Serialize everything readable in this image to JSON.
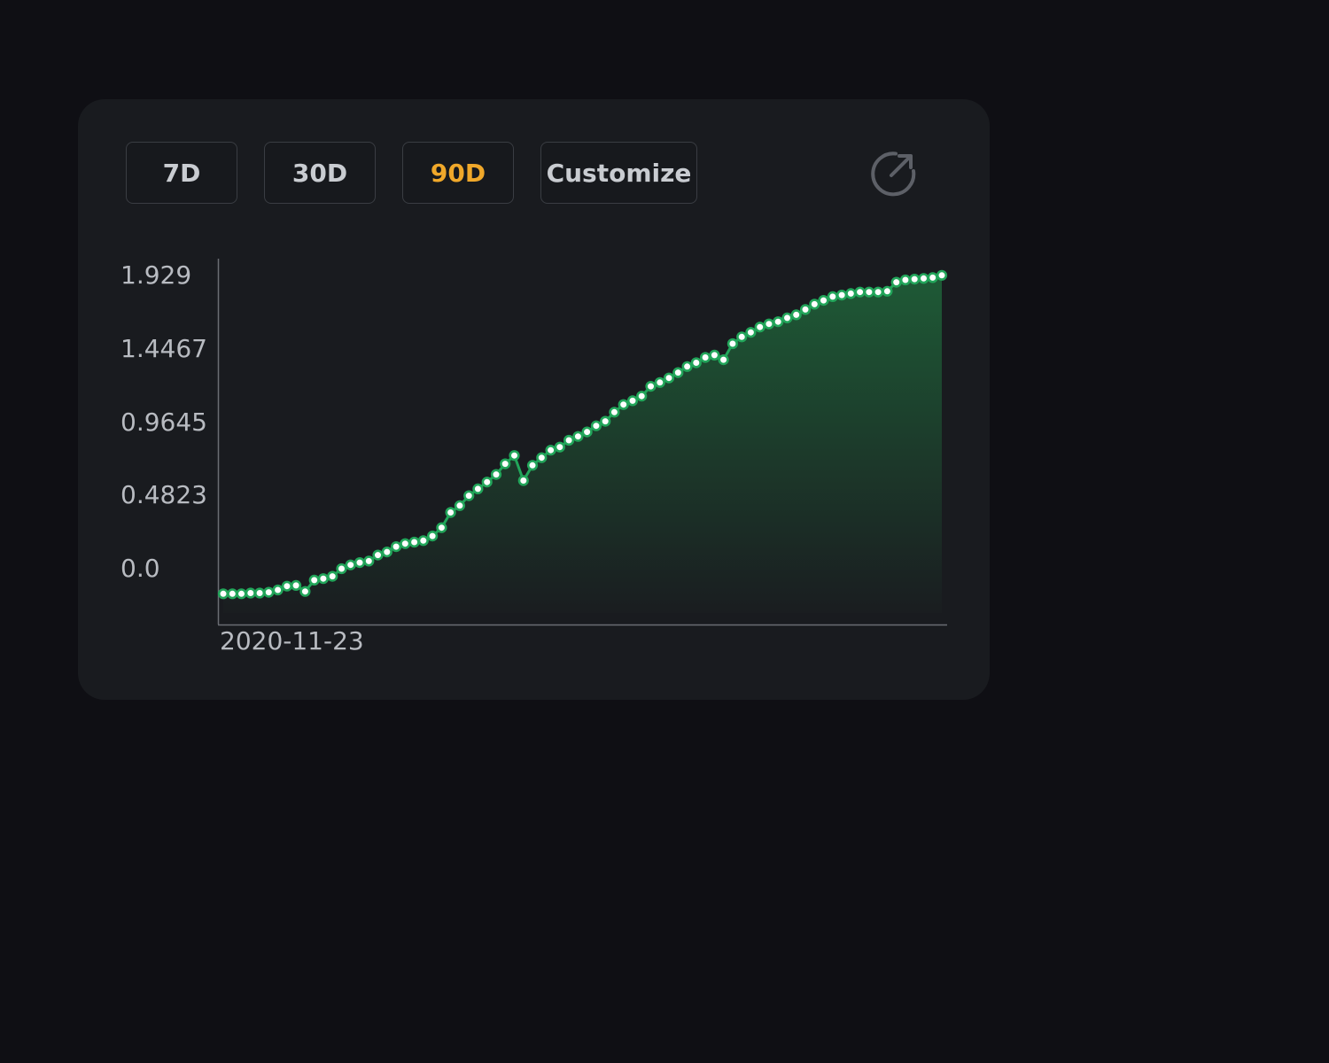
{
  "toolbar": {
    "ranges": [
      {
        "label": "7D",
        "active": false
      },
      {
        "label": "30D",
        "active": false
      },
      {
        "label": "90D",
        "active": true
      },
      {
        "label": "Customize",
        "active": false
      }
    ],
    "share_icon": "share-export-icon"
  },
  "colors": {
    "background": "#0f0f14",
    "card": "#191b1f",
    "active": "#f0a82a",
    "line": "#22a55a",
    "area_top": "#1e5a36",
    "area_bottom": "#1a1d20"
  },
  "chart_data": {
    "type": "line",
    "y_ticks": [
      "1.929",
      "1.4467",
      "0.9645",
      "0.4823",
      "0.0"
    ],
    "x_ticks": [
      "2020-11-23"
    ],
    "ylim": [
      0.0,
      1.929
    ],
    "grid": false,
    "legend": "none",
    "values": [
      -0.165,
      -0.165,
      -0.165,
      -0.16,
      -0.16,
      -0.155,
      -0.14,
      -0.115,
      -0.11,
      -0.15,
      -0.075,
      -0.065,
      -0.05,
      0.0,
      0.025,
      0.04,
      0.05,
      0.09,
      0.11,
      0.145,
      0.165,
      0.175,
      0.185,
      0.215,
      0.27,
      0.37,
      0.415,
      0.48,
      0.525,
      0.57,
      0.62,
      0.69,
      0.745,
      0.58,
      0.68,
      0.73,
      0.78,
      0.8,
      0.845,
      0.87,
      0.9,
      0.94,
      0.97,
      1.03,
      1.08,
      1.105,
      1.135,
      1.2,
      1.225,
      1.255,
      1.29,
      1.33,
      1.355,
      1.39,
      1.405,
      1.375,
      1.48,
      1.525,
      1.555,
      1.59,
      1.61,
      1.625,
      1.65,
      1.67,
      1.705,
      1.74,
      1.765,
      1.79,
      1.8,
      1.81,
      1.82,
      1.82,
      1.82,
      1.825,
      1.885,
      1.9,
      1.905,
      1.91,
      1.915,
      1.93
    ]
  }
}
